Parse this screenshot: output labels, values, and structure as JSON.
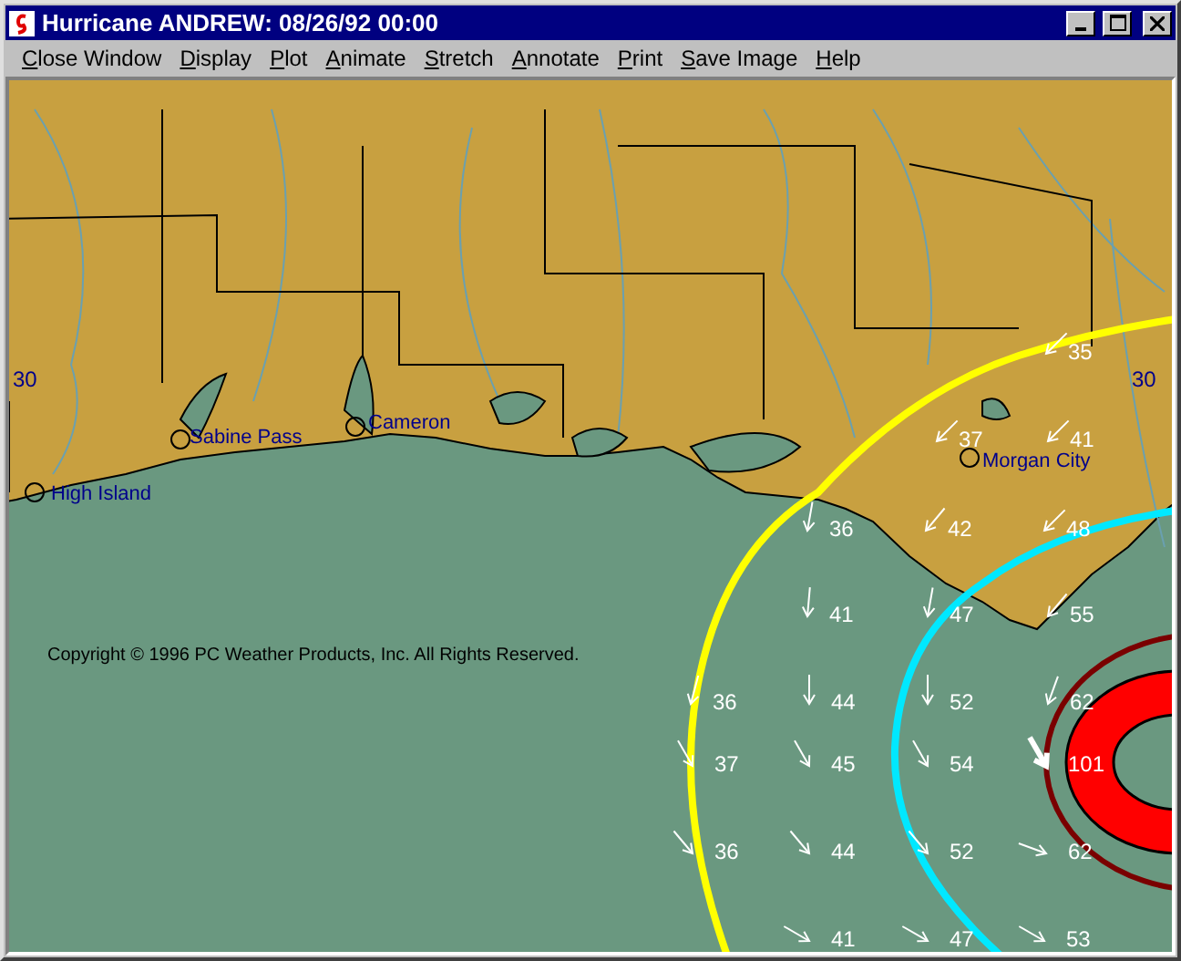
{
  "window": {
    "title": "Hurricane ANDREW: 08/26/92 00:00"
  },
  "menu": [
    "Close Window",
    "Display",
    "Plot",
    "Animate",
    "Stretch",
    "Annotate",
    "Print",
    "Save Image",
    "Help"
  ],
  "map": {
    "latitude_labels": [
      "30",
      "30"
    ],
    "cities": [
      "Sabine Pass",
      "Cameron",
      "High Island",
      "Morgan City"
    ],
    "copyright": "Copyright © 1996 PC Weather Products, Inc. All Rights Reserved.",
    "wind": [
      {
        "value": "35",
        "kind": "normal"
      },
      {
        "value": "37",
        "kind": "normal"
      },
      {
        "value": "41",
        "kind": "normal"
      },
      {
        "value": "36",
        "kind": "normal"
      },
      {
        "value": "42",
        "kind": "normal"
      },
      {
        "value": "48",
        "kind": "normal"
      },
      {
        "value": "41",
        "kind": "normal"
      },
      {
        "value": "47",
        "kind": "normal"
      },
      {
        "value": "55",
        "kind": "normal"
      },
      {
        "value": "36",
        "kind": "normal"
      },
      {
        "value": "44",
        "kind": "normal"
      },
      {
        "value": "52",
        "kind": "normal"
      },
      {
        "value": "62",
        "kind": "normal"
      },
      {
        "value": "37",
        "kind": "normal"
      },
      {
        "value": "45",
        "kind": "normal"
      },
      {
        "value": "54",
        "kind": "normal"
      },
      {
        "value": "101",
        "kind": "strong"
      },
      {
        "value": "36",
        "kind": "normal"
      },
      {
        "value": "44",
        "kind": "normal"
      },
      {
        "value": "52",
        "kind": "normal"
      },
      {
        "value": "62",
        "kind": "normal"
      },
      {
        "value": "41",
        "kind": "normal"
      },
      {
        "value": "47",
        "kind": "normal"
      },
      {
        "value": "53",
        "kind": "normal"
      }
    ]
  }
}
